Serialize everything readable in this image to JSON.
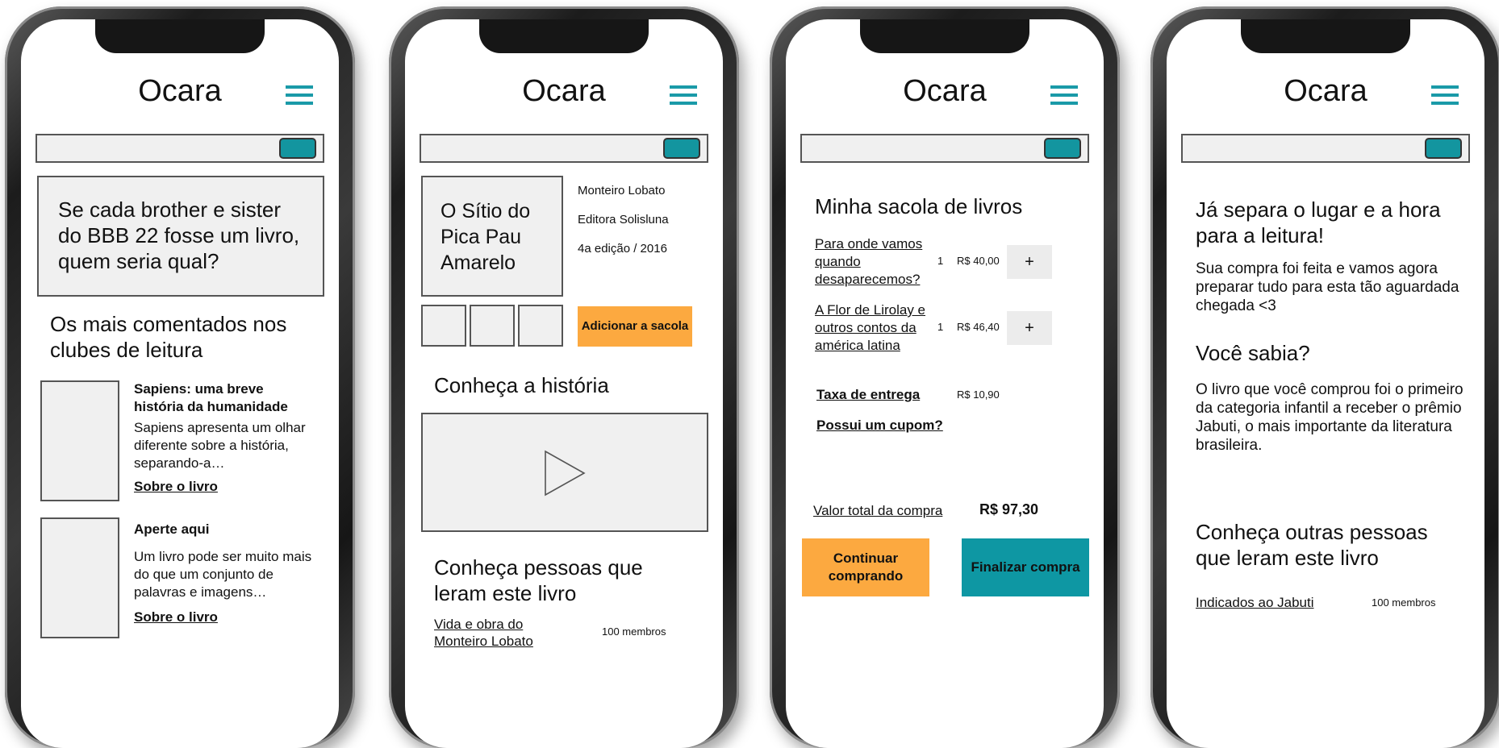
{
  "app_title": "Ocara",
  "screen1": {
    "banner": "Se cada brother e sister do BBB 22 fosse um livro, quem seria qual?",
    "section_title": "Os mais comentados nos clubes de leitura",
    "books": [
      {
        "title": "Sapiens: uma breve história da humanidade",
        "desc": "Sapiens apresenta um olhar diferente sobre a história, separando-a…",
        "link": "Sobre o livro"
      },
      {
        "title": "Aperte aqui",
        "desc": "Um livro pode ser muito mais do que um conjunto de palavras e imagens…",
        "link": "Sobre o livro"
      }
    ]
  },
  "screen2": {
    "cover_title": "O Sítio do Pica Pau Amarelo",
    "author": "Monteiro Lobato",
    "publisher": "Editora Solisluna",
    "edition": "4a edição / 2016",
    "add_button": "Adicionar a sacola",
    "history_title": "Conheça a história",
    "readers_title": "Conheça pessoas que leram este livro",
    "club_link": "Vida e obra do Monteiro Lobato",
    "club_members": "100 membros"
  },
  "screen3": {
    "title": "Minha sacola de livros",
    "items": [
      {
        "name": "Para onde vamos quando desaparecemos?",
        "qty": "1",
        "price": "R$ 40,00",
        "action": "+"
      },
      {
        "name": "A Flor de Lirolay e outros contos da américa latina",
        "qty": "1",
        "price": "R$ 46,40",
        "action": "+"
      }
    ],
    "delivery_label": "Taxa de entrega",
    "delivery_price": "R$ 10,90",
    "coupon_label": "Possui um cupom?",
    "total_label": "Valor total da compra",
    "total_value": "R$ 97,30",
    "continue_button": "Continuar comprando",
    "finish_button": "Finalizar compra"
  },
  "screen4": {
    "heading": "Já separa o lugar e a hora para a leitura!",
    "message": "Sua compra foi feita e vamos agora preparar tudo para esta tão aguardada chegada <3",
    "did_you_know": "Você sabia?",
    "fact": "O livro que você comprou foi o primeiro da categoria infantil a receber o prêmio Jabuti, o mais importante da literatura brasileira.",
    "others_title": "Conheça outras pessoas que leram este livro",
    "club_link": "Indicados ao Jabuti",
    "club_members": "100 membros"
  },
  "colors": {
    "accent_teal": "#13959f",
    "accent_orange": "#fca940",
    "placeholder_gray": "#f0f0f0"
  },
  "icons": [
    "hamburger-menu-icon",
    "play-icon"
  ]
}
